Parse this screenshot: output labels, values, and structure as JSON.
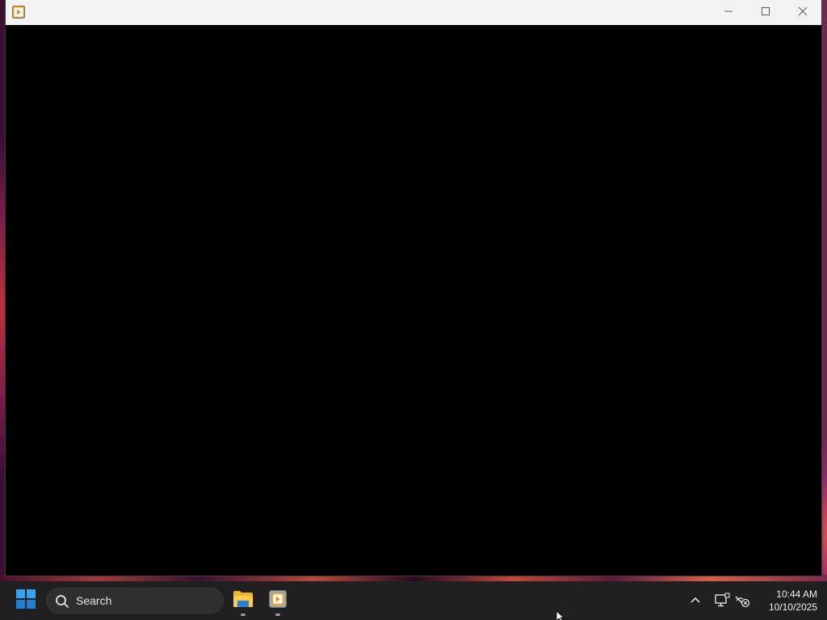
{
  "window": {
    "title": "",
    "icon": "media-player-icon",
    "controls": [
      "minimize-icon",
      "maximize-icon",
      "close-icon"
    ],
    "content_color": "#000000"
  },
  "taskbar": {
    "start_icon": "windows-logo-icon",
    "search": {
      "placeholder": "Search",
      "icon": "search-icon"
    },
    "apps": [
      {
        "name": "File Explorer",
        "icon": "folder-icon",
        "running": true
      },
      {
        "name": "Media Player",
        "icon": "media-player-icon",
        "running": true
      }
    ],
    "tray": {
      "icons": [
        "chevron-up-icon",
        "display-icon",
        "network-disconnected-icon"
      ],
      "time": "10:44 AM",
      "date": "10/10/2025"
    }
  },
  "colors": {
    "taskbar_bg": "#202020",
    "titlebar_bg": "#f3f3f3",
    "windows_blue": "#1e90ff"
  }
}
